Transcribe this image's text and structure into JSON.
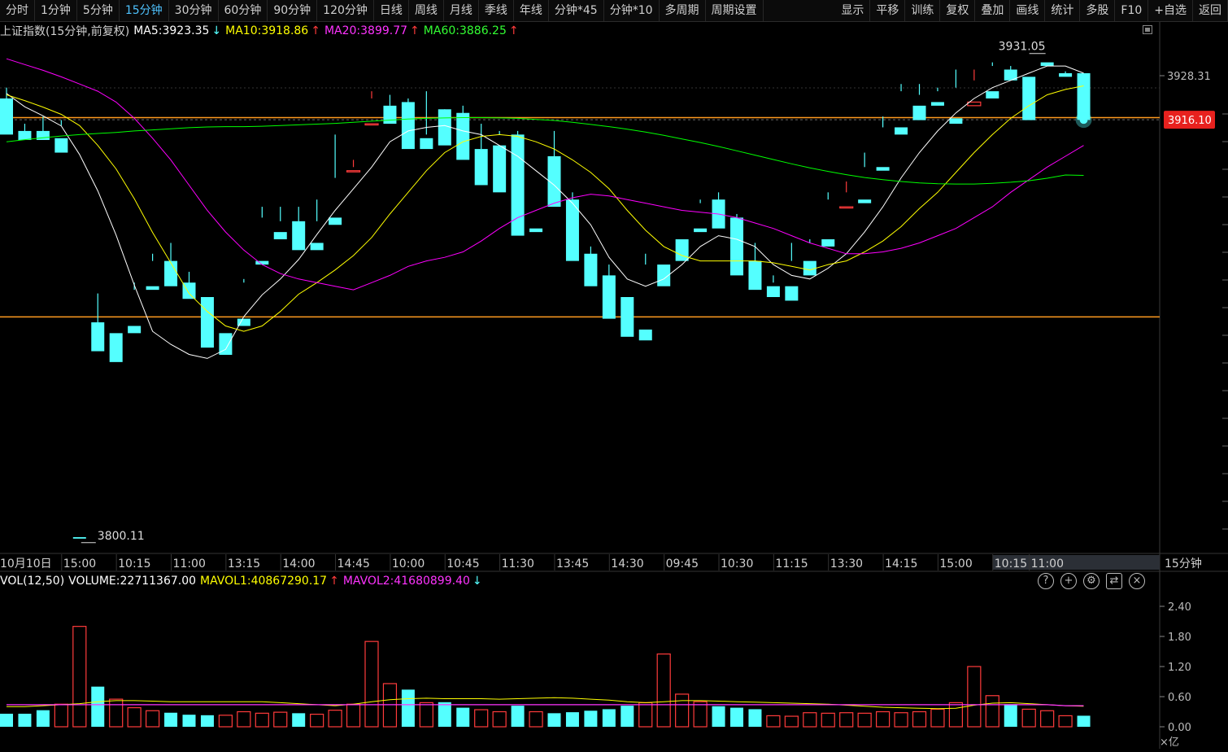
{
  "toolbar": {
    "items": [
      "分时",
      "1分钟",
      "5分钟",
      "15分钟",
      "30分钟",
      "60分钟",
      "90分钟",
      "120分钟",
      "日线",
      "周线",
      "月线",
      "季线",
      "年线",
      "分钟*45",
      "分钟*10",
      "多周期",
      "周期设置"
    ],
    "active_index": 3,
    "right_items": [
      "显示",
      "平移",
      "训练",
      "复权",
      "叠加",
      "画线",
      "统计",
      "多股",
      "F10",
      "+自选",
      "返回"
    ]
  },
  "info": {
    "title": "上证指数(15分钟,前复权)",
    "ma5": "MA5:3923.35",
    "ma5_arrow": "↓",
    "ma10": "MA10:3918.86",
    "ma10_arrow": "↑",
    "ma20": "MA20:3899.77",
    "ma20_arrow": "↑",
    "ma60": "MA60:3886.25",
    "ma60_arrow": "↑"
  },
  "vol_info": {
    "title": "VOL(12,50)",
    "volume": "VOLUME:22711367.00",
    "mavol1": "MAVOL1:40867290.17",
    "mavol1_arrow": "↑",
    "mavol2": "MAVOL2:41680899.40",
    "mavol2_arrow": "↓"
  },
  "vol_icons": [
    "help-icon",
    "zoom-in-icon",
    "settings-icon",
    "swap-icon",
    "close-icon"
  ],
  "colors": {
    "up": "#ff3b3b",
    "down": "#54ffff",
    "ma5": "#ffffff",
    "ma10": "#ffff00",
    "ma20": "#ff00ff",
    "ma60": "#00ff00",
    "hline": "#ff9a1f",
    "badge": "#e8211e"
  },
  "chart_data": {
    "type": "candlestick",
    "period_label": "15分钟",
    "price_tick": "3928.31",
    "current_price": "3916.10",
    "high_label": "3931.05",
    "low_label": "3800.11",
    "ylim": [
      3796,
      3938
    ],
    "horizontal_lines": [
      3916.7,
      3861.5
    ],
    "x_ticks": [
      {
        "i": 0,
        "t": "10月10日"
      },
      {
        "i": 4,
        "t": "15:00"
      },
      {
        "i": 7,
        "t": "10:15"
      },
      {
        "i": 10,
        "t": "11:00"
      },
      {
        "i": 13,
        "t": "13:15"
      },
      {
        "i": 16,
        "t": "14:00"
      },
      {
        "i": 19,
        "t": "14:45"
      },
      {
        "i": 22,
        "t": "10:00"
      },
      {
        "i": 25,
        "t": "10:45"
      },
      {
        "i": 28,
        "t": "11:30"
      },
      {
        "i": 31,
        "t": "13:45"
      },
      {
        "i": 34,
        "t": "14:30"
      },
      {
        "i": 37,
        "t": "09:45"
      },
      {
        "i": 40,
        "t": "10:30"
      },
      {
        "i": 43,
        "t": "11:15"
      },
      {
        "i": 46,
        "t": "13:30"
      },
      {
        "i": 49,
        "t": "14:15"
      },
      {
        "i": 52,
        "t": "15:00"
      },
      {
        "i": 55,
        "t": "10:15"
      },
      {
        "i": 57,
        "t": "11:00"
      }
    ],
    "candles": [
      [
        3922.0,
        3925.0,
        3914.0,
        3912.0
      ],
      [
        3913.0,
        3915.0,
        3911.0,
        3910.5
      ],
      [
        3913.0,
        3917.0,
        3912.0,
        3910.5
      ],
      [
        3911.0,
        3916.0,
        3914.5,
        3907.0
      ],
      [
        3800.5,
        3862.0,
        3862.0,
        3800.1
      ],
      [
        3860.0,
        3868.0,
        3854.0,
        3852.0
      ],
      [
        3857.0,
        3859.0,
        3859.0,
        3849.0
      ],
      [
        3859.0,
        3871.0,
        3869.0,
        3857.0
      ],
      [
        3870.0,
        3879.0,
        3877.0,
        3869.0
      ],
      [
        3877.0,
        3882.0,
        3872.0,
        3870.0
      ],
      [
        3871.0,
        3874.0,
        3867.0,
        3866.5
      ],
      [
        3867.0,
        3867.0,
        3857.0,
        3853.0
      ],
      [
        3857.0,
        3861.0,
        3861.0,
        3851.0
      ],
      [
        3861.0,
        3872.0,
        3871.0,
        3859.0
      ],
      [
        3877.0,
        3892.0,
        3889.0,
        3876.0
      ],
      [
        3885.0,
        3892.0,
        3888.0,
        3883.0
      ],
      [
        3888.0,
        3892.0,
        3885.0,
        3880.0
      ],
      [
        3882.0,
        3894.0,
        3888.0,
        3880.0
      ],
      [
        3889.0,
        3912.0,
        3900.0,
        3887.0
      ],
      [
        3902.0,
        3905.0,
        3903.0,
        3902.0
      ],
      [
        3915.0,
        3924.0,
        3922.0,
        3915.0
      ],
      [
        3920.0,
        3923.0,
        3920.0,
        3915.0
      ],
      [
        3921.0,
        3922.0,
        3911.0,
        3908.0
      ],
      [
        3911.0,
        3924.0,
        3912.0,
        3908.0
      ],
      [
        3919.0,
        3919.0,
        3918.0,
        3909.0
      ],
      [
        3918.0,
        3920.0,
        3906.5,
        3905.0
      ],
      [
        3908.0,
        3915.0,
        3908.0,
        3898.0
      ],
      [
        3909.0,
        3913.0,
        3912.0,
        3896.0
      ],
      [
        3912.0,
        3913.0,
        3886.0,
        3884.0
      ],
      [
        3886.0,
        3912.0,
        3912.0,
        3885.0
      ],
      [
        3906.0,
        3913.0,
        3894.0,
        3892.0
      ],
      [
        3894.0,
        3896.0,
        3879.0,
        3877.0
      ],
      [
        3879.0,
        3881.0,
        3873.0,
        3870.0
      ],
      [
        3873.0,
        3876.0,
        3863.0,
        3861.0
      ],
      [
        3867.0,
        3867.0,
        3859.0,
        3856.0
      ],
      [
        3858.0,
        3879.0,
        3876.0,
        3855.0
      ],
      [
        3876.0,
        3883.0,
        3883.0,
        3870.0
      ],
      [
        3883.0,
        3886.0,
        3886.0,
        3877.0
      ],
      [
        3886.0,
        3893.0,
        3894.0,
        3885.0
      ],
      [
        3894.0,
        3896.0,
        3889.0,
        3886.0
      ],
      [
        3889.0,
        3890.0,
        3877.0,
        3873.0
      ],
      [
        3877.0,
        3882.0,
        3870.0,
        3869.0
      ],
      [
        3870.0,
        3873.0,
        3871.0,
        3867.0
      ],
      [
        3870.0,
        3882.0,
        3877.0,
        3866.0
      ],
      [
        3877.0,
        3882.0,
        3883.0,
        3873.0
      ],
      [
        3883.0,
        3896.0,
        3894.0,
        3881.0
      ],
      [
        3892.0,
        3899.0,
        3896.0,
        3892.0
      ],
      [
        3894.0,
        3907.0,
        3903.0,
        3893.0
      ],
      [
        3903.0,
        3917.0,
        3914.0,
        3902.0
      ],
      [
        3914.0,
        3926.0,
        3924.0,
        3912.0
      ],
      [
        3920.0,
        3926.0,
        3923.0,
        3916.0
      ],
      [
        3921.0,
        3924.0,
        3925.0,
        3920.0
      ],
      [
        3916.5,
        3930.0,
        3925.0,
        3915.0
      ],
      [
        3920.0,
        3930.0,
        3927.0,
        3921.0
      ],
      [
        3924.0,
        3932.0,
        3931.0,
        3922.0
      ],
      [
        3930.0,
        3931.0,
        3928.5,
        3927.0
      ],
      [
        3928.0,
        3932.0,
        3932.0,
        3916.0
      ],
      [
        3932.0,
        3934.0,
        3934.0,
        3931.0
      ],
      [
        3929.0,
        3929.5,
        3929.0,
        3928.0
      ],
      [
        3929.0,
        3929.0,
        3916.1,
        3916.1
      ]
    ],
    "ma_series": [
      {
        "name": "MA5",
        "values": [
          3923.4,
          3919.7,
          3917.2,
          3914.4,
          3906.5,
          3896.4,
          3884.2,
          3870.3,
          3857.5,
          3853.9,
          3851.1,
          3850.0,
          3852.5,
          3861.6,
          3867.6,
          3872.0,
          3877.4,
          3884.3,
          3891.0,
          3897.0,
          3903.0,
          3910.0,
          3913.0,
          3914.0,
          3914.5,
          3913.0,
          3912.0,
          3909.0,
          3906.0,
          3902.0,
          3898.0,
          3893.0,
          3887.0,
          3878.0,
          3872.0,
          3870.0,
          3872.0,
          3876.0,
          3881.0,
          3884.0,
          3883.0,
          3881.0,
          3876.0,
          3873.0,
          3872.0,
          3875.0,
          3879.0,
          3885.0,
          3892.0,
          3900.0,
          3907.0,
          3913.0,
          3918.0,
          3922.0,
          3925.0,
          3927.0,
          3929.0,
          3931.0,
          3931.0,
          3929.0
        ]
      },
      {
        "name": "MA10",
        "values": [
          3923.0,
          3921.4,
          3919.6,
          3917.6,
          3914.5,
          3909.0,
          3902.5,
          3894.2,
          3884.9,
          3876.5,
          3868.0,
          3863.0,
          3859.0,
          3857.5,
          3859.0,
          3863.0,
          3867.8,
          3871.0,
          3874.5,
          3878.5,
          3883.5,
          3890.0,
          3896.0,
          3902.0,
          3907.0,
          3910.0,
          3911.5,
          3912.0,
          3911.5,
          3910.0,
          3908.0,
          3905.0,
          3901.5,
          3897.0,
          3891.0,
          3885.5,
          3881.0,
          3878.5,
          3877.0,
          3877.0,
          3877.0,
          3877.0,
          3876.5,
          3875.5,
          3874.5,
          3876.0,
          3877.0,
          3879.5,
          3882.5,
          3886.5,
          3891.5,
          3896.0,
          3901.5,
          3907.0,
          3912.0,
          3916.5,
          3920.0,
          3923.0,
          3924.5,
          3925.5
        ]
      },
      {
        "name": "MA20",
        "values": [
          3933.0,
          3931.4,
          3929.8,
          3928.0,
          3926.0,
          3924.0,
          3921.0,
          3916.5,
          3911.0,
          3905.0,
          3898.0,
          3891.0,
          3885.0,
          3880.0,
          3876.0,
          3873.5,
          3872.0,
          3871.0,
          3870.0,
          3869.0,
          3871.0,
          3873.0,
          3875.5,
          3877.0,
          3878.0,
          3879.5,
          3882.5,
          3886.0,
          3889.0,
          3891.0,
          3893.0,
          3894.5,
          3895.5,
          3895.0,
          3894.0,
          3893.0,
          3892.0,
          3891.0,
          3890.5,
          3890.0,
          3889.0,
          3887.5,
          3886.0,
          3884.0,
          3882.0,
          3880.5,
          3879.0,
          3879.0,
          3879.5,
          3880.5,
          3882.0,
          3884.0,
          3886.0,
          3889.0,
          3892.0,
          3896.0,
          3899.5,
          3903.0,
          3906.0,
          3909.0
        ]
      },
      {
        "name": "MA60",
        "values": [
          3910.0,
          3910.6,
          3911.1,
          3911.6,
          3912.0,
          3912.3,
          3912.6,
          3913.0,
          3913.3,
          3913.6,
          3913.9,
          3914.1,
          3914.2,
          3914.2,
          3914.3,
          3914.5,
          3914.7,
          3914.9,
          3915.1,
          3915.4,
          3915.7,
          3916.0,
          3916.3,
          3916.5,
          3916.6,
          3916.7,
          3916.7,
          3916.6,
          3916.5,
          3916.2,
          3915.9,
          3915.4,
          3914.8,
          3914.2,
          3913.5,
          3912.7,
          3911.8,
          3910.8,
          3909.8,
          3908.7,
          3907.5,
          3906.3,
          3905.1,
          3903.9,
          3902.8,
          3901.8,
          3900.9,
          3900.1,
          3899.5,
          3899.0,
          3898.6,
          3898.4,
          3898.3,
          3898.3,
          3898.5,
          3898.8,
          3899.2,
          3899.9,
          3900.8,
          3900.7
        ]
      }
    ],
    "volume": {
      "ylim": [
        0,
        2.4
      ],
      "y_ticks": [
        "2.40",
        "1.80",
        "1.20",
        "0.60",
        "0.00"
      ],
      "unit": "×亿",
      "values": [
        0.26,
        0.26,
        0.33,
        0.45,
        2.0,
        0.8,
        0.55,
        0.38,
        0.32,
        0.28,
        0.24,
        0.23,
        0.23,
        0.3,
        0.27,
        0.29,
        0.27,
        0.25,
        0.33,
        0.45,
        1.7,
        0.86,
        0.74,
        0.48,
        0.49,
        0.38,
        0.34,
        0.3,
        0.42,
        0.3,
        0.27,
        0.29,
        0.32,
        0.35,
        0.42,
        0.48,
        1.45,
        0.65,
        0.5,
        0.41,
        0.38,
        0.35,
        0.22,
        0.21,
        0.28,
        0.27,
        0.28,
        0.27,
        0.3,
        0.28,
        0.3,
        0.35,
        0.48,
        1.2,
        0.62,
        0.45,
        0.35,
        0.32,
        0.22,
        0.22
      ],
      "mavol1": [
        0.4,
        0.4,
        0.42,
        0.44,
        0.46,
        0.5,
        0.52,
        0.52,
        0.51,
        0.5,
        0.5,
        0.5,
        0.5,
        0.5,
        0.5,
        0.48,
        0.46,
        0.44,
        0.42,
        0.45,
        0.5,
        0.54,
        0.56,
        0.57,
        0.56,
        0.56,
        0.56,
        0.55,
        0.56,
        0.57,
        0.58,
        0.57,
        0.55,
        0.53,
        0.5,
        0.48,
        0.5,
        0.52,
        0.52,
        0.51,
        0.5,
        0.49,
        0.48,
        0.47,
        0.46,
        0.45,
        0.43,
        0.41,
        0.39,
        0.38,
        0.37,
        0.36,
        0.37,
        0.43,
        0.47,
        0.48,
        0.46,
        0.44,
        0.42,
        0.41
      ],
      "mavol2": [
        0.44,
        0.44,
        0.44,
        0.44,
        0.44,
        0.44,
        0.44,
        0.44,
        0.44,
        0.44,
        0.44,
        0.44,
        0.44,
        0.44,
        0.44,
        0.44,
        0.44,
        0.44,
        0.44,
        0.44,
        0.44,
        0.44,
        0.44,
        0.44,
        0.44,
        0.44,
        0.44,
        0.44,
        0.44,
        0.44,
        0.44,
        0.44,
        0.44,
        0.44,
        0.44,
        0.44,
        0.44,
        0.44,
        0.44,
        0.44,
        0.44,
        0.44,
        0.44,
        0.44,
        0.44,
        0.44,
        0.44,
        0.44,
        0.44,
        0.44,
        0.44,
        0.44,
        0.44,
        0.44,
        0.44,
        0.44,
        0.44,
        0.44,
        0.42,
        0.42
      ]
    }
  }
}
